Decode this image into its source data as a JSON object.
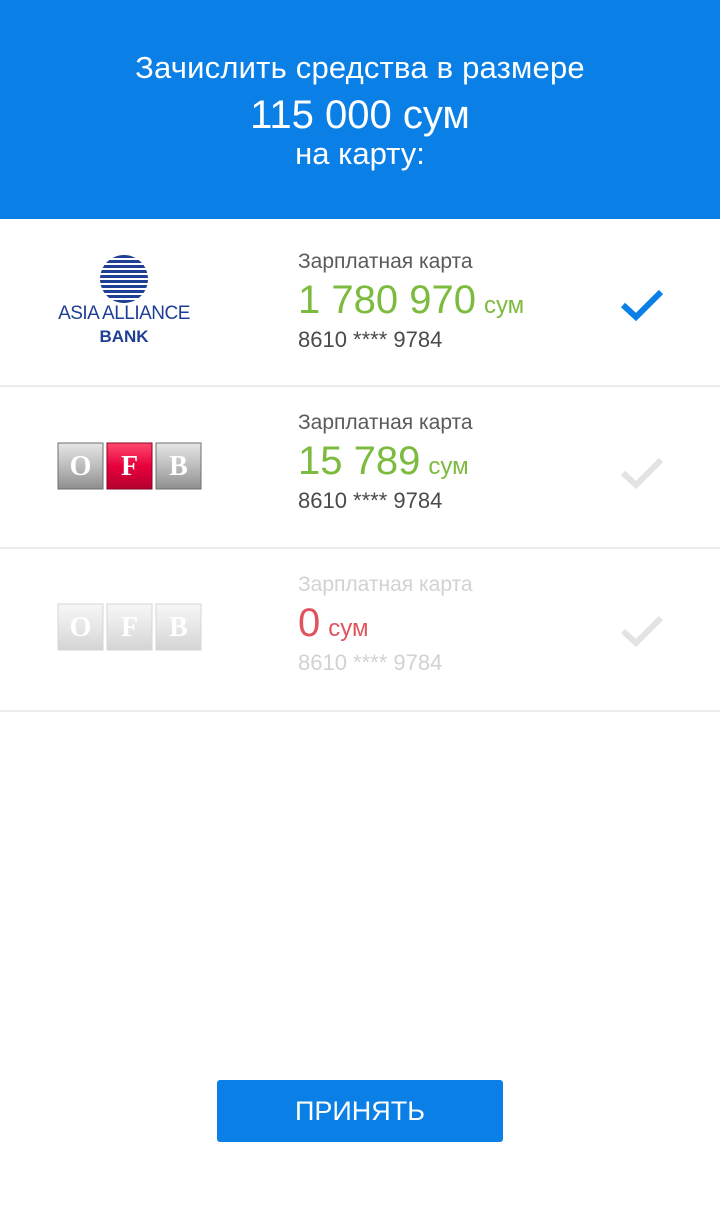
{
  "header": {
    "line1": "Зачислить средства в размере",
    "amount": "115 000 сум",
    "line3": "на карту:"
  },
  "cards": [
    {
      "bank": "ASIA ALLIANCE BANK",
      "logo_text_top": "ASIA ALLIANCE",
      "logo_text_bottom": "BANK",
      "label": "Зарплатная карта",
      "balance": "1 780 970",
      "currency": "сум",
      "number": "8610 **** 9784",
      "selected": true,
      "enabled": true
    },
    {
      "bank": "OFB",
      "logo_letters": [
        "O",
        "F",
        "B"
      ],
      "label": "Зарплатная карта",
      "balance": "15 789",
      "currency": "сум",
      "number": "8610 **** 9784",
      "selected": false,
      "enabled": true
    },
    {
      "bank": "OFB",
      "logo_letters": [
        "O",
        "F",
        "B"
      ],
      "label": "Зарплатная карта",
      "balance": "0",
      "currency": "сум",
      "number": "8610 **** 9784",
      "selected": false,
      "enabled": false
    }
  ],
  "accept_button": {
    "label": "ПРИНЯТЬ"
  },
  "colors": {
    "accent": "#0a7fe6",
    "balance_positive": "#7cbb3d",
    "balance_zero": "#e0545e",
    "check_inactive": "#e0e0e0",
    "ofb_red": "#e8003d",
    "asia_blue": "#1f3f95"
  },
  "icons": {
    "selected": "checkmark-icon",
    "unselected": "checkmark-icon"
  }
}
